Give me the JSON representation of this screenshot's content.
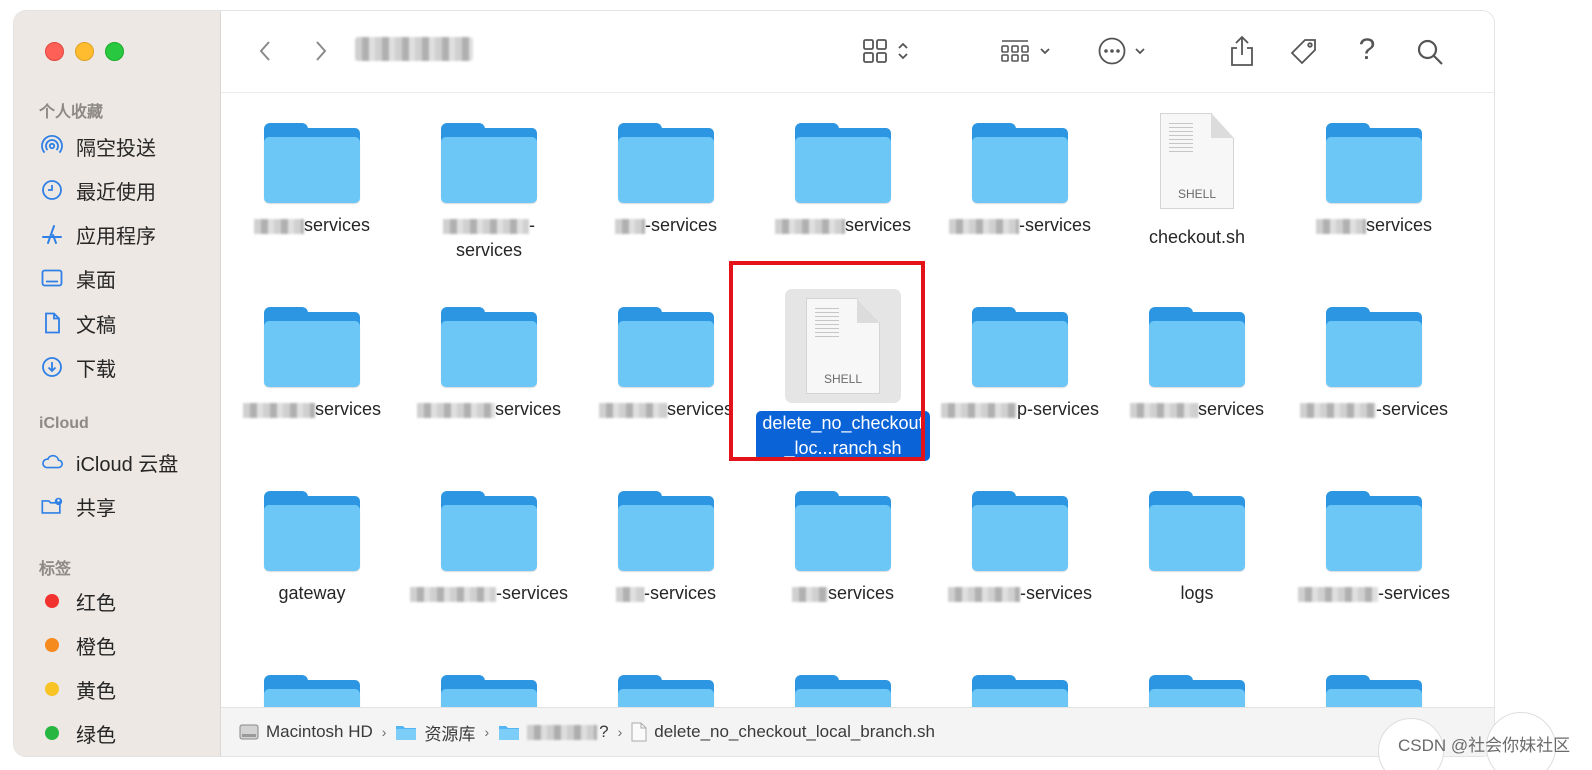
{
  "sidebar": {
    "sections": [
      {
        "title": "个人收藏",
        "items": [
          {
            "label": "隔空投送",
            "icon": "airdrop-icon"
          },
          {
            "label": "最近使用",
            "icon": "clock-icon"
          },
          {
            "label": "应用程序",
            "icon": "applications-icon"
          },
          {
            "label": "桌面",
            "icon": "desktop-icon"
          },
          {
            "label": "文稿",
            "icon": "document-icon"
          },
          {
            "label": "下载",
            "icon": "download-icon"
          }
        ]
      },
      {
        "title": "iCloud",
        "items": [
          {
            "label": "iCloud 云盘",
            "icon": "cloud-icon"
          },
          {
            "label": "共享",
            "icon": "shared-folder-icon"
          }
        ]
      },
      {
        "title": "标签",
        "items": [
          {
            "label": "红色",
            "color": "#f2322f"
          },
          {
            "label": "橙色",
            "color": "#f58a1f"
          },
          {
            "label": "黄色",
            "color": "#f7c325"
          },
          {
            "label": "绿色",
            "color": "#27b740"
          }
        ]
      }
    ]
  },
  "files": [
    {
      "label": "services",
      "kind": "folder"
    },
    {
      "label": "-",
      "label2": "services",
      "kind": "folder"
    },
    {
      "label": "-services",
      "kind": "folder"
    },
    {
      "label": "services",
      "kind": "folder"
    },
    {
      "label": "-services",
      "kind": "folder"
    },
    {
      "label": "checkout.sh",
      "kind": "shell",
      "type_label": "SHELL"
    },
    {
      "label": "services",
      "kind": "folder"
    },
    {
      "label": "services",
      "kind": "folder"
    },
    {
      "label": "services",
      "kind": "folder"
    },
    {
      "label": "services",
      "kind": "folder"
    },
    {
      "label": "delete_no_checkout_loc...ranch.sh",
      "kind": "shell",
      "type_label": "SHELL",
      "selected": true
    },
    {
      "label": "p-services",
      "kind": "folder"
    },
    {
      "label": "services",
      "kind": "folder"
    },
    {
      "label": "-services",
      "kind": "folder"
    },
    {
      "label": "gateway",
      "kind": "folder"
    },
    {
      "label": "-services",
      "kind": "folder"
    },
    {
      "label": "-services",
      "kind": "folder"
    },
    {
      "label": "services",
      "kind": "folder"
    },
    {
      "label": "-services",
      "kind": "folder"
    },
    {
      "label": "logs",
      "kind": "folder"
    },
    {
      "label": "-services",
      "kind": "folder"
    }
  ],
  "pathbar": {
    "crumbs": [
      "Macintosh HD",
      "资源库",
      "?",
      "delete_no_checkout_local_branch.sh"
    ]
  },
  "watermark": "CSDN @社会你妹社区"
}
